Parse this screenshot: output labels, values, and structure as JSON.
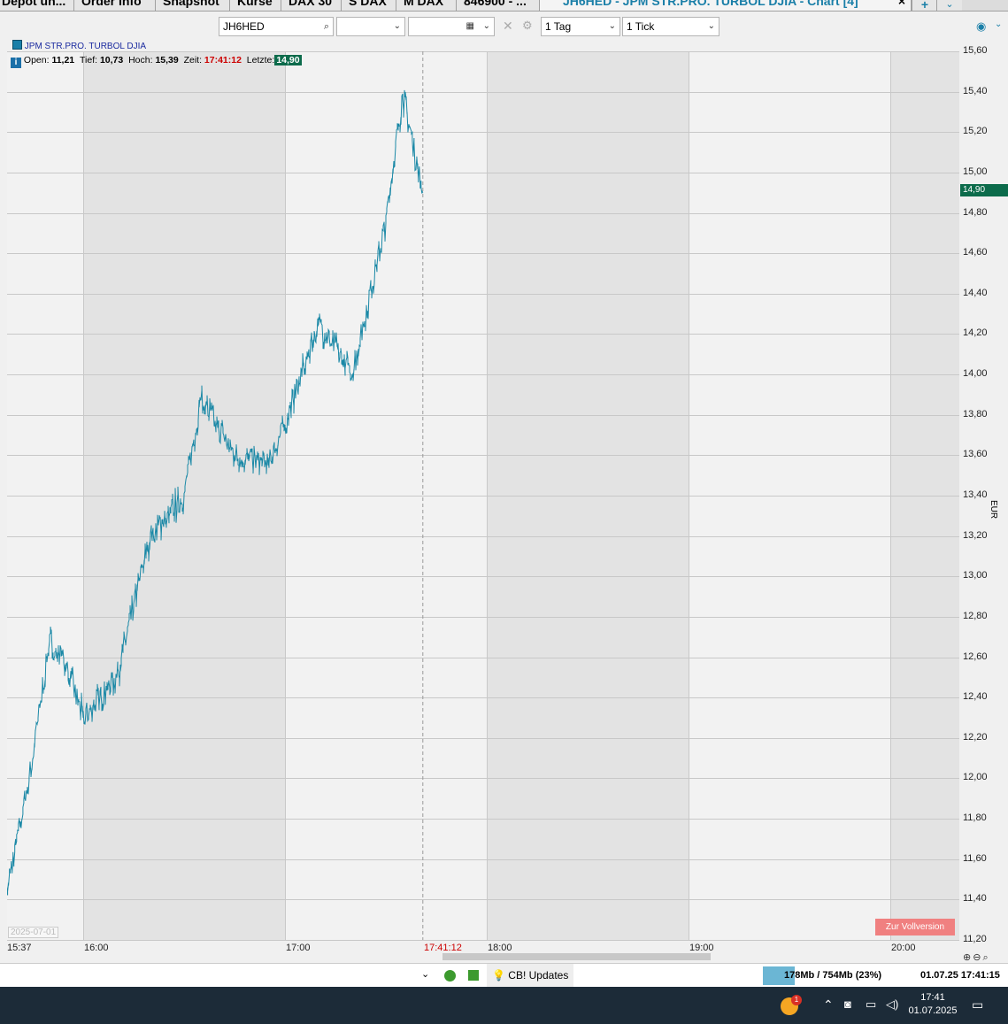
{
  "tabs": [
    {
      "label": "Depot un...",
      "active": false
    },
    {
      "label": "Order Info",
      "active": false
    },
    {
      "label": "Snapshot",
      "active": false
    },
    {
      "label": "Kurse",
      "active": false
    },
    {
      "label": "DAX 30",
      "active": false
    },
    {
      "label": "S DAX",
      "active": false
    },
    {
      "label": "M DAX",
      "active": false
    },
    {
      "label": "846900 - ...",
      "active": false
    },
    {
      "label": "JH6HED - JPM STR.PRO. TURBOL DJIA - Chart [4]",
      "active": true
    }
  ],
  "tab_controls": {
    "close": "×",
    "add": "+",
    "menu": "⌄"
  },
  "toolbar": {
    "symbol": "JH6HED",
    "select1": "",
    "select2": "",
    "period": "1 Tag",
    "interval": "1 Tick"
  },
  "chart": {
    "legend": "JPM STR.PRO. TURBOL DJIA",
    "info": {
      "open_label": "Open:",
      "open": "11,21",
      "low_label": "Tief:",
      "low": "10,73",
      "high_label": "Hoch:",
      "high": "15,39",
      "time_label": "Zeit:",
      "time": "17:41:12",
      "last_label": "Letzte:",
      "last": "14,90"
    },
    "last_price_tag": "14,90",
    "date_tag": "2025-07-01",
    "cursor_time": "17:41:12",
    "unit": "EUR",
    "upgrade_button": "Zur Vollversion",
    "colors": {
      "line": "#1a88a6",
      "last_tag": "#0c6b4b",
      "upgrade": "#f08080",
      "time_red": "#cc0000"
    }
  },
  "chart_data": {
    "type": "line",
    "x": [
      "15:37",
      "15:45",
      "15:50",
      "15:55",
      "16:00",
      "16:10",
      "16:20",
      "16:30",
      "16:35",
      "16:45",
      "16:55",
      "17:00",
      "17:10",
      "17:20",
      "17:30",
      "17:35",
      "17:41"
    ],
    "values": [
      11.41,
      12.1,
      12.68,
      12.55,
      12.3,
      12.5,
      13.2,
      13.4,
      13.88,
      13.6,
      13.55,
      13.75,
      14.25,
      14.0,
      14.75,
      15.39,
      14.9
    ],
    "ylim": [
      11.2,
      15.6
    ],
    "yticks": [
      "15,60",
      "15,40",
      "15,20",
      "15,00",
      "14,80",
      "14,60",
      "14,40",
      "14,20",
      "14,00",
      "13,80",
      "13,60",
      "13,40",
      "13,20",
      "13,00",
      "12,80",
      "12,60",
      "12,40",
      "12,20",
      "12,00",
      "11,80",
      "11,60",
      "11,40",
      "11,20"
    ],
    "xticks": [
      "15:37",
      "16:00",
      "17:00",
      "18:00",
      "19:00",
      "20:00"
    ],
    "ylabel": "EUR"
  },
  "statusbar": {
    "updates": "CB! Updates",
    "memory": "178Mb / 754Mb (23%)",
    "datetime": "01.07.25  17:41:15"
  },
  "taskbar": {
    "time": "17:41",
    "date": "01.07.2025",
    "badge": "1"
  }
}
